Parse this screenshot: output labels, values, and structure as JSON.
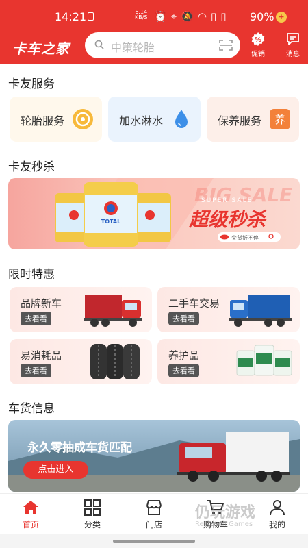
{
  "status_bar": {
    "time": "14:21",
    "speed_value": "6.14",
    "speed_unit": "KB/S",
    "battery": "90%"
  },
  "header": {
    "logo_text": "卡车之家",
    "search_placeholder": "中策轮胎",
    "promo_label": "促销",
    "message_label": "消息"
  },
  "services": {
    "title": "卡友服务",
    "items": [
      {
        "label": "轮胎服务",
        "icon": "tire-badge-icon"
      },
      {
        "label": "加水淋水",
        "icon": "water-drop-icon"
      },
      {
        "label": "保养服务",
        "icon": "maintenance-badge-icon",
        "badge_text": "养"
      }
    ]
  },
  "flash_sale": {
    "title": "卡友秒杀",
    "banner": {
      "super_sale": "SUPER SALE",
      "headline": "超级秒杀",
      "tagline": "尖货折不停",
      "bg_text": "BIG SALE",
      "brand": "TOTAL"
    }
  },
  "limited": {
    "title": "限时特惠",
    "cta": "去看看",
    "items": [
      {
        "name": "品牌新车",
        "image": "red-truck"
      },
      {
        "name": "二手车交易",
        "image": "blue-truck"
      },
      {
        "name": "易消耗品",
        "image": "tires"
      },
      {
        "name": "养护品",
        "image": "buckets"
      }
    ]
  },
  "cargo": {
    "title": "车货信息",
    "banner_text": "永久零抽成车货匹配",
    "button": "点击进入"
  },
  "nav": {
    "items": [
      {
        "label": "首页",
        "active": true
      },
      {
        "label": "分类",
        "active": false
      },
      {
        "label": "门店",
        "active": false
      },
      {
        "label": "购物车",
        "active": false
      },
      {
        "label": "我的",
        "active": false
      }
    ]
  },
  "watermark": {
    "main": "仍玩游戏",
    "sub": "Rengwan Games"
  },
  "colors": {
    "brand_red": "#e8352f",
    "water_blue": "#3d8fe8",
    "orange": "#f3813a"
  }
}
